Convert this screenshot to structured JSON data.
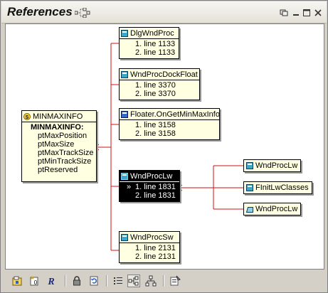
{
  "window": {
    "title": "References"
  },
  "nodes": {
    "minmaxinfo": {
      "title": "MINMAXINFO",
      "struct_name": "MINMAXINFO:",
      "fields": [
        "ptMaxPosition",
        "ptMaxSize",
        "ptMaxTrackSize",
        "ptMinTrackSize",
        "ptReserved"
      ]
    },
    "dlgwndproc": {
      "title": "DlgWndProc",
      "lines": [
        "1. line 1133",
        "2. line 1133"
      ]
    },
    "wndprocdockfloat": {
      "title": "WndProcDockFloat",
      "lines": [
        "1. line 3370",
        "2. line 3370"
      ]
    },
    "floater": {
      "title": "Floater.OnGetMinMaxInfo",
      "lines": [
        "1. line 3158",
        "2. line 3158"
      ]
    },
    "wndproclw": {
      "title": "WndProcLw",
      "marker": "»",
      "lines": [
        "1. line 1831",
        "2. line 1831"
      ]
    },
    "wndprocsw": {
      "title": "WndProcSw",
      "lines": [
        "1. line 2131",
        "2. line 2131"
      ]
    },
    "callers": [
      {
        "title": "WndProcLw"
      },
      {
        "title": "FInitLwClasses"
      },
      {
        "title": "WndProcLw"
      }
    ]
  },
  "colors": {
    "wire": "#d01010",
    "node_bg": "#ffffe1",
    "selected_bg": "#000000"
  }
}
